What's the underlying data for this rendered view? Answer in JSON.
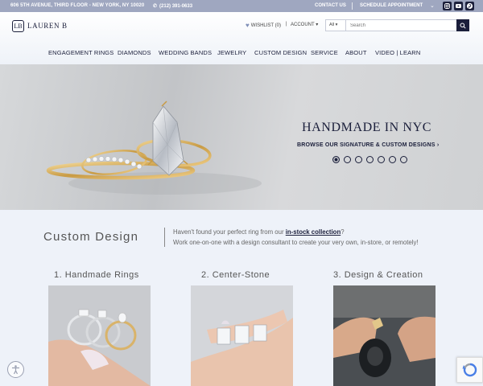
{
  "topbar": {
    "address": "606 5TH AVENUE, THIRD FLOOR - NEW YORK, NY 10020",
    "phone": "(212) 391-0633",
    "contact": "CONTACT US",
    "schedule": "SCHEDULE APPOINTMENT",
    "social_icons": [
      "instagram-icon",
      "youtube-icon",
      "pinterest-icon"
    ]
  },
  "header": {
    "logo_mark": "LB",
    "logo_text": "LAUREN B",
    "wishlist": "WISHLIST (0)",
    "separator": "|",
    "account": "ACCOUNT",
    "search_category": "All",
    "search_placeholder": "Search"
  },
  "nav": [
    "ENGAGEMENT RINGS",
    "DIAMONDS",
    "WEDDING BANDS",
    "JEWELRY",
    "CUSTOM DESIGN",
    "SERVICE",
    "ABOUT",
    "VIDEO | LEARN"
  ],
  "hero": {
    "title": "HANDMADE IN NYC",
    "subtitle": "BROWSE OUR SIGNATURE & CUSTOM DESIGNS",
    "slide_count": 7,
    "active_slide": 1
  },
  "custom": {
    "title": "Custom Design",
    "text_before_link": "Haven't found your perfect ring from our ",
    "link": "in-stock collection",
    "text_after_link": "?",
    "text_line2": "Work one-on-one with a design consultant to create your very own, in-store, or remotely!"
  },
  "steps": [
    "1. Handmade Rings",
    "2. Center-Stone",
    "3. Design & Creation"
  ],
  "colors": {
    "navy": "#1b1f3b",
    "topbar": "#9fa7c0",
    "section_bg": "#eef2f9"
  }
}
